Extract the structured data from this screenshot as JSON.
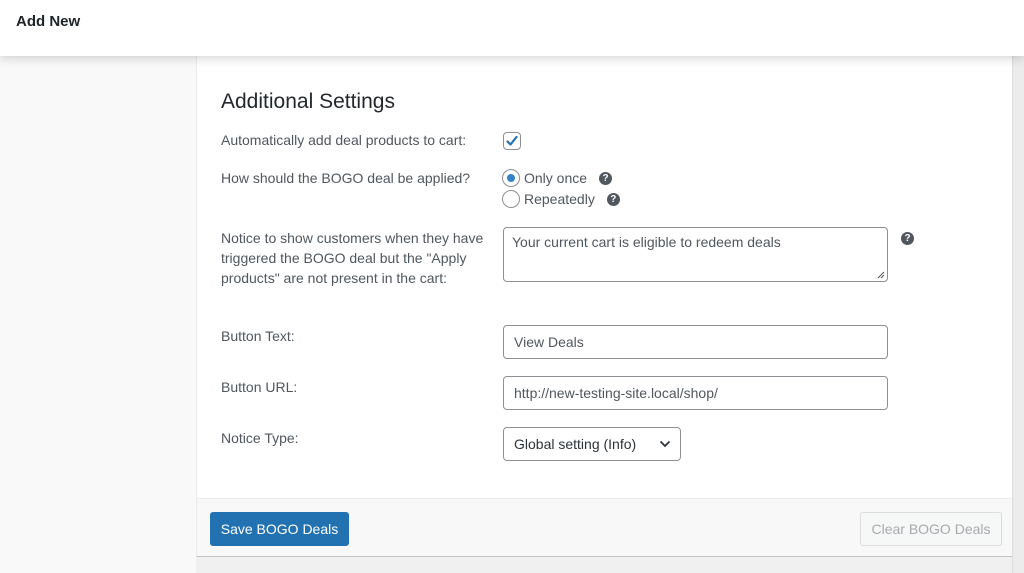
{
  "header": {
    "title": "Add New"
  },
  "section": {
    "title": "Additional Settings"
  },
  "fields": {
    "auto_add": {
      "label": "Automatically add deal products to cart:",
      "checked": true
    },
    "apply_mode": {
      "label": "How should the BOGO deal be applied?",
      "options": [
        {
          "label": "Only once",
          "selected": true,
          "help_icon": "question-circle-icon"
        },
        {
          "label": "Repeatedly",
          "selected": false,
          "help_icon": "question-circle-icon"
        }
      ]
    },
    "notice": {
      "label": "Notice to show customers when they have triggered the BOGO deal but the \"Apply products\" are not present in the cart:",
      "value": "Your current cart is eligible to redeem deals",
      "help_icon": "question-circle-icon"
    },
    "button_text": {
      "label": "Button Text:",
      "value": "View Deals"
    },
    "button_url": {
      "label": "Button URL:",
      "value": "http://new-testing-site.local/shop/"
    },
    "notice_type": {
      "label": "Notice Type:",
      "selected": "Global setting (Info)"
    }
  },
  "footer": {
    "save_label": "Save BOGO Deals",
    "clear_label": "Clear BOGO Deals"
  },
  "colors": {
    "primary": "#2271b1",
    "radio_accent": "#3582c4"
  }
}
